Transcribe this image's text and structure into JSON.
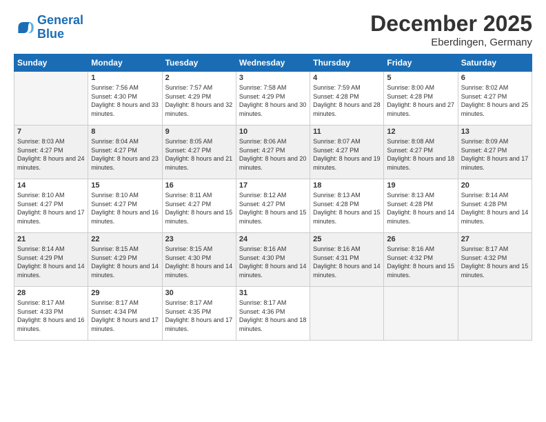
{
  "logo": {
    "line1": "General",
    "line2": "Blue"
  },
  "title": "December 2025",
  "location": "Eberdingen, Germany",
  "weekdays": [
    "Sunday",
    "Monday",
    "Tuesday",
    "Wednesday",
    "Thursday",
    "Friday",
    "Saturday"
  ],
  "weeks": [
    [
      {
        "day": "",
        "sunrise": "",
        "sunset": "",
        "daylight": ""
      },
      {
        "day": "1",
        "sunrise": "Sunrise: 7:56 AM",
        "sunset": "Sunset: 4:30 PM",
        "daylight": "Daylight: 8 hours and 33 minutes."
      },
      {
        "day": "2",
        "sunrise": "Sunrise: 7:57 AM",
        "sunset": "Sunset: 4:29 PM",
        "daylight": "Daylight: 8 hours and 32 minutes."
      },
      {
        "day": "3",
        "sunrise": "Sunrise: 7:58 AM",
        "sunset": "Sunset: 4:29 PM",
        "daylight": "Daylight: 8 hours and 30 minutes."
      },
      {
        "day": "4",
        "sunrise": "Sunrise: 7:59 AM",
        "sunset": "Sunset: 4:28 PM",
        "daylight": "Daylight: 8 hours and 28 minutes."
      },
      {
        "day": "5",
        "sunrise": "Sunrise: 8:00 AM",
        "sunset": "Sunset: 4:28 PM",
        "daylight": "Daylight: 8 hours and 27 minutes."
      },
      {
        "day": "6",
        "sunrise": "Sunrise: 8:02 AM",
        "sunset": "Sunset: 4:27 PM",
        "daylight": "Daylight: 8 hours and 25 minutes."
      }
    ],
    [
      {
        "day": "7",
        "sunrise": "Sunrise: 8:03 AM",
        "sunset": "Sunset: 4:27 PM",
        "daylight": "Daylight: 8 hours and 24 minutes."
      },
      {
        "day": "8",
        "sunrise": "Sunrise: 8:04 AM",
        "sunset": "Sunset: 4:27 PM",
        "daylight": "Daylight: 8 hours and 23 minutes."
      },
      {
        "day": "9",
        "sunrise": "Sunrise: 8:05 AM",
        "sunset": "Sunset: 4:27 PM",
        "daylight": "Daylight: 8 hours and 21 minutes."
      },
      {
        "day": "10",
        "sunrise": "Sunrise: 8:06 AM",
        "sunset": "Sunset: 4:27 PM",
        "daylight": "Daylight: 8 hours and 20 minutes."
      },
      {
        "day": "11",
        "sunrise": "Sunrise: 8:07 AM",
        "sunset": "Sunset: 4:27 PM",
        "daylight": "Daylight: 8 hours and 19 minutes."
      },
      {
        "day": "12",
        "sunrise": "Sunrise: 8:08 AM",
        "sunset": "Sunset: 4:27 PM",
        "daylight": "Daylight: 8 hours and 18 minutes."
      },
      {
        "day": "13",
        "sunrise": "Sunrise: 8:09 AM",
        "sunset": "Sunset: 4:27 PM",
        "daylight": "Daylight: 8 hours and 17 minutes."
      }
    ],
    [
      {
        "day": "14",
        "sunrise": "Sunrise: 8:10 AM",
        "sunset": "Sunset: 4:27 PM",
        "daylight": "Daylight: 8 hours and 17 minutes."
      },
      {
        "day": "15",
        "sunrise": "Sunrise: 8:10 AM",
        "sunset": "Sunset: 4:27 PM",
        "daylight": "Daylight: 8 hours and 16 minutes."
      },
      {
        "day": "16",
        "sunrise": "Sunrise: 8:11 AM",
        "sunset": "Sunset: 4:27 PM",
        "daylight": "Daylight: 8 hours and 15 minutes."
      },
      {
        "day": "17",
        "sunrise": "Sunrise: 8:12 AM",
        "sunset": "Sunset: 4:27 PM",
        "daylight": "Daylight: 8 hours and 15 minutes."
      },
      {
        "day": "18",
        "sunrise": "Sunrise: 8:13 AM",
        "sunset": "Sunset: 4:28 PM",
        "daylight": "Daylight: 8 hours and 15 minutes."
      },
      {
        "day": "19",
        "sunrise": "Sunrise: 8:13 AM",
        "sunset": "Sunset: 4:28 PM",
        "daylight": "Daylight: 8 hours and 14 minutes."
      },
      {
        "day": "20",
        "sunrise": "Sunrise: 8:14 AM",
        "sunset": "Sunset: 4:28 PM",
        "daylight": "Daylight: 8 hours and 14 minutes."
      }
    ],
    [
      {
        "day": "21",
        "sunrise": "Sunrise: 8:14 AM",
        "sunset": "Sunset: 4:29 PM",
        "daylight": "Daylight: 8 hours and 14 minutes."
      },
      {
        "day": "22",
        "sunrise": "Sunrise: 8:15 AM",
        "sunset": "Sunset: 4:29 PM",
        "daylight": "Daylight: 8 hours and 14 minutes."
      },
      {
        "day": "23",
        "sunrise": "Sunrise: 8:15 AM",
        "sunset": "Sunset: 4:30 PM",
        "daylight": "Daylight: 8 hours and 14 minutes."
      },
      {
        "day": "24",
        "sunrise": "Sunrise: 8:16 AM",
        "sunset": "Sunset: 4:30 PM",
        "daylight": "Daylight: 8 hours and 14 minutes."
      },
      {
        "day": "25",
        "sunrise": "Sunrise: 8:16 AM",
        "sunset": "Sunset: 4:31 PM",
        "daylight": "Daylight: 8 hours and 14 minutes."
      },
      {
        "day": "26",
        "sunrise": "Sunrise: 8:16 AM",
        "sunset": "Sunset: 4:32 PM",
        "daylight": "Daylight: 8 hours and 15 minutes."
      },
      {
        "day": "27",
        "sunrise": "Sunrise: 8:17 AM",
        "sunset": "Sunset: 4:32 PM",
        "daylight": "Daylight: 8 hours and 15 minutes."
      }
    ],
    [
      {
        "day": "28",
        "sunrise": "Sunrise: 8:17 AM",
        "sunset": "Sunset: 4:33 PM",
        "daylight": "Daylight: 8 hours and 16 minutes."
      },
      {
        "day": "29",
        "sunrise": "Sunrise: 8:17 AM",
        "sunset": "Sunset: 4:34 PM",
        "daylight": "Daylight: 8 hours and 17 minutes."
      },
      {
        "day": "30",
        "sunrise": "Sunrise: 8:17 AM",
        "sunset": "Sunset: 4:35 PM",
        "daylight": "Daylight: 8 hours and 17 minutes."
      },
      {
        "day": "31",
        "sunrise": "Sunrise: 8:17 AM",
        "sunset": "Sunset: 4:36 PM",
        "daylight": "Daylight: 8 hours and 18 minutes."
      },
      {
        "day": "",
        "sunrise": "",
        "sunset": "",
        "daylight": ""
      },
      {
        "day": "",
        "sunrise": "",
        "sunset": "",
        "daylight": ""
      },
      {
        "day": "",
        "sunrise": "",
        "sunset": "",
        "daylight": ""
      }
    ]
  ]
}
